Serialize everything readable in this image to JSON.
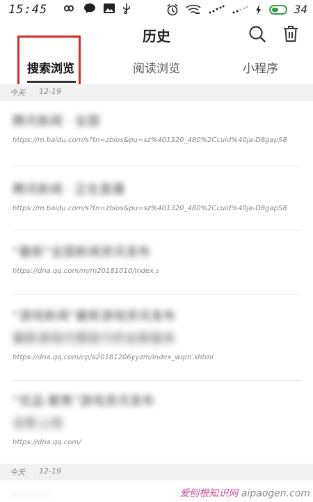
{
  "status_bar": {
    "time": "15:45",
    "battery": "34"
  },
  "header": {
    "title": "历史"
  },
  "tabs": [
    {
      "label": "搜索浏览",
      "active": true
    },
    {
      "label": "阅读浏览",
      "active": false
    },
    {
      "label": "小程序",
      "active": false
    }
  ],
  "sections": [
    {
      "day": "今天",
      "date": "12-19"
    },
    {
      "day": "今天",
      "date": "12-19"
    }
  ],
  "items": [
    {
      "title": "腾讯新闻 · 全国",
      "title2": "",
      "url": "https://m.baidu.com/s?tn=zbios&pu=sz%401320_480%2Ccuid%40ja-D8gapS8…"
    },
    {
      "title": "腾讯新闻 · 正在直播",
      "title2": "",
      "url": "https://m.baidu.com/s?tn=zbios&pu=sz%401320_480%2Ccuid%40ja-D8gapS8…"
    },
    {
      "title": "“最新”全国新闻资讯发布",
      "title2": "",
      "url": "https://dna.qq.com/m/m20181010/index.shtml"
    },
    {
      "title": "“游戏新闻”最新游戏资讯发布",
      "title2": "最新游戏代理发行的全新版本",
      "url": "https://dna.qq.com/cp/a20181206yyzm/index_wqm.shtml"
    },
    {
      "title": "“优品·聚焦”游戏资讯发布",
      "title2": "全新上线",
      "url": "https://dna.qq.com/"
    }
  ],
  "watermark": {
    "text": "爱刨根知识网",
    "domain": "aipaogen.com"
  },
  "colors": {
    "accent_red": "#d2292b",
    "battery_green": "#2d9e3e"
  }
}
